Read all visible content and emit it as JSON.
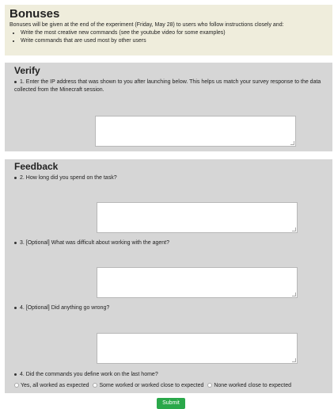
{
  "bonuses": {
    "title": "Bonuses",
    "text": "Bonuses will be given at the end of the experiment (Friday, May 28) to users who follow instructions closely and:",
    "items": [
      "Write the most creative new commands (see the youtube video for some examples)",
      "Write commands that are used most by other users"
    ]
  },
  "verify": {
    "title": "Verify",
    "question": "1. Enter the IP address that was shown to you after launching below. This helps us match your survey response to the data collected from the Minecraft session.",
    "answer": ""
  },
  "feedback": {
    "title": "Feedback",
    "q2": "2. How long did you spend on the task?",
    "q3": "3. [Optional] What was difficult about working with the agent?",
    "q4": "4. [Optional] Did anything go wrong?",
    "q5": "4. Did the commands you define work on the last home?",
    "q5_options": [
      "Yes, all worked as expected",
      "Some worked or worked close to expected",
      "None worked close to expected"
    ],
    "answers": {
      "q2": "",
      "q3": "",
      "q4": ""
    }
  },
  "submit_label": "Submit"
}
